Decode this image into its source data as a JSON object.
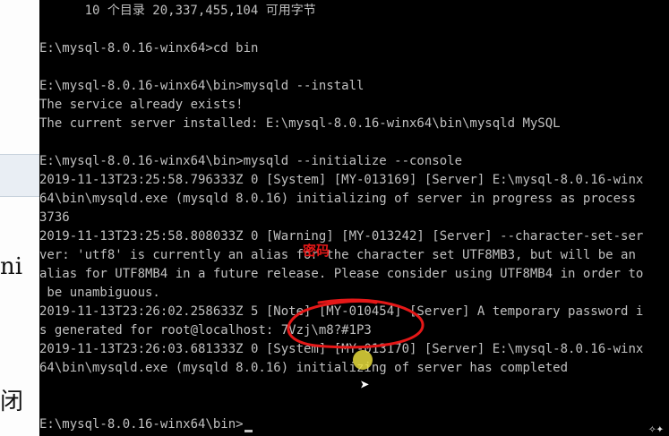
{
  "background_window": {
    "fragments": [
      "ni",
      "闭"
    ]
  },
  "console": {
    "text_color": "#c0c0c0",
    "background": "#000000",
    "lines": [
      "      10 个目录 20,337,455,104 可用字节",
      "",
      "E:\\mysql-8.0.16-winx64>cd bin",
      "",
      "E:\\mysql-8.0.16-winx64\\bin>mysqld --install",
      "The service already exists!",
      "The current server installed: E:\\mysql-8.0.16-winx64\\bin\\mysqld MySQL",
      "",
      "E:\\mysql-8.0.16-winx64\\bin>mysqld --initialize --console",
      "2019-11-13T23:25:58.796333Z 0 [System] [MY-013169] [Server] E:\\mysql-8.0.16-winx",
      "64\\bin\\mysqld.exe (mysqld 8.0.16) initializing of server in progress as process",
      "3736",
      "2019-11-13T23:25:58.808033Z 0 [Warning] [MY-013242] [Server] --character-set-ser",
      "ver: 'utf8' is currently an alias for the character set UTF8MB3, but will be an",
      "alias for UTF8MB4 in a future release. Please consider using UTF8MB4 in order to",
      " be unambiguous.",
      "2019-11-13T23:26:02.258633Z 5 [Note] [MY-010454] [Server] A temporary password i",
      "s generated for root@localhost: 7Vzj\\m8?#1P3",
      "2019-11-13T23:26:03.681333Z 0 [System] [MY-013170] [Server] E:\\mysql-8.0.16-winx",
      "64\\bin\\mysqld.exe (mysqld 8.0.16) initializing of server has completed",
      "",
      "",
      "E:\\mysql-8.0.16-winx64\\bin>"
    ]
  },
  "annotation": {
    "note_text": "密码",
    "color": "#e51818"
  },
  "corner_icon": "sparkle-icon"
}
